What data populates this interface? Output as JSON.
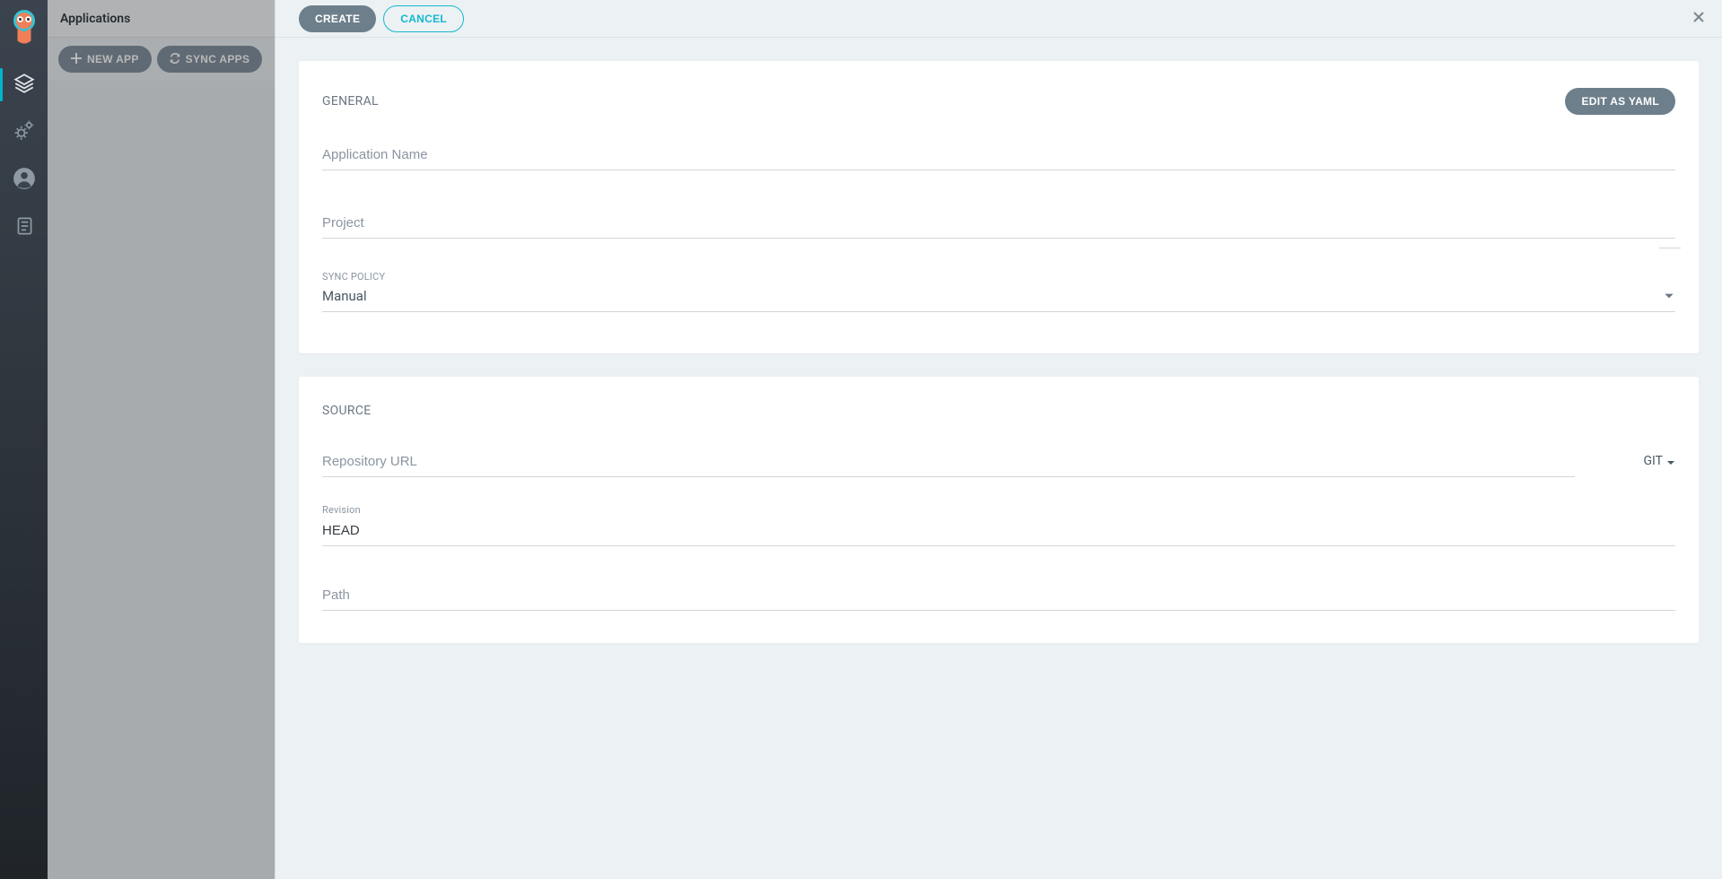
{
  "sidebar": {
    "title": "Applications",
    "new_app_label": "NEW APP",
    "sync_apps_label": "SYNC APPS"
  },
  "panel": {
    "create_label": "CREATE",
    "cancel_label": "CANCEL",
    "edit_yaml_label": "EDIT AS YAML"
  },
  "general": {
    "title": "GENERAL",
    "app_name_placeholder": "Application Name",
    "app_name_value": "",
    "project_placeholder": "Project",
    "project_value": "",
    "sync_policy_label": "SYNC POLICY",
    "sync_policy_value": "Manual"
  },
  "source": {
    "title": "SOURCE",
    "repo_url_placeholder": "Repository URL",
    "repo_url_value": "",
    "repo_type_label": "GIT",
    "revision_label": "Revision",
    "revision_value": "HEAD",
    "path_placeholder": "Path",
    "path_value": ""
  }
}
